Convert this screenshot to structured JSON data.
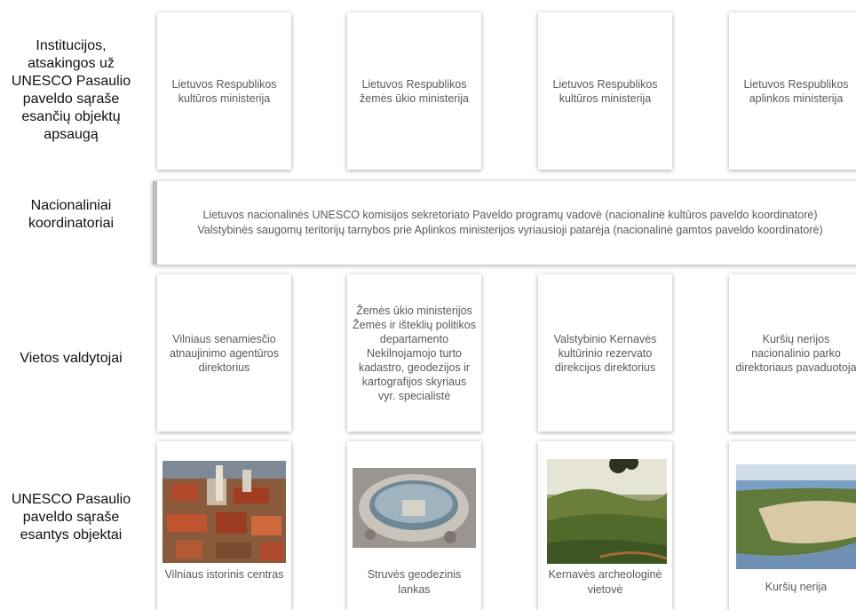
{
  "rows": {
    "institutions": "Institucijos,\natsakingos už\nUNESCO Pasaulio\npaveldo sąraše\nesančių objektų\napsaugą",
    "coordinators": "Nacionaliniai\nkoordinatoriai",
    "managers": "Vietos valdytojai",
    "sites": "UNESCO Pasaulio\npaveldo sąraše\nesantys objektai"
  },
  "institutions": [
    "Lietuvos Respublikos kultūros ministerija",
    "Lietuvos Respublikos žemės ūkio ministerija",
    "Lietuvos Respublikos kultūros ministerija",
    "Lietuvos Respublikos aplinkos ministerija"
  ],
  "coordinators": {
    "line1": "Lietuvos nacionalinės UNESCO komisijos sekretoriato Paveldo programų vadovė (nacionalinė kultūros paveldo koordinatorė)",
    "line2": "Valstybinės saugomų teritorijų tarnybos prie Aplinkos ministerijos vyriausioji patarėja (nacionalinė gamtos paveldo koordinatorė)"
  },
  "managers": [
    "Vilniaus senamiesčio atnaujinimo agentūros direktorius",
    "Žemės ūkio ministerijos Žemės ir išteklių politikos departamento Nekilnojamojo turto kadastro, geodezijos ir kartografijos skyriaus vyr. specialistė",
    "Valstybinio Kernavės kultūrinio rezervato direkcijos direktorius",
    "Kuršių nerijos nacionalinio parko direktoriaus pavaduotoja"
  ],
  "sites": [
    "Vilniaus istorinis centras",
    "Struvės geodezinis lankas",
    "Kernavės archeologinė vietovė",
    "Kuršių nerija"
  ]
}
